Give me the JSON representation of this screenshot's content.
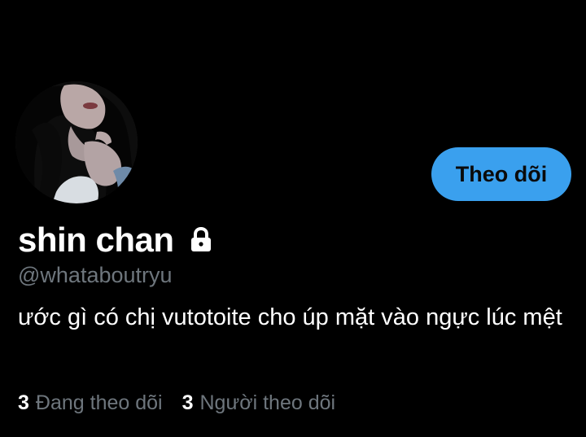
{
  "profile": {
    "display_name": "shin chan",
    "handle": "@whataboutryu",
    "bio": "ước gì có chị vutotoite cho úp mặt vào ngực lúc mệt",
    "protected_icon": "lock-icon",
    "avatar_icon": "avatar-photo"
  },
  "actions": {
    "follow_label": "Theo dõi"
  },
  "stats": {
    "following": {
      "count": "3",
      "label": "Đang theo dõi"
    },
    "followers": {
      "count": "3",
      "label": "Người theo dõi"
    }
  },
  "colors": {
    "background": "#000000",
    "accent": "#3aa0ee",
    "secondary_text": "#6e767d",
    "primary_text": "#ffffff"
  }
}
